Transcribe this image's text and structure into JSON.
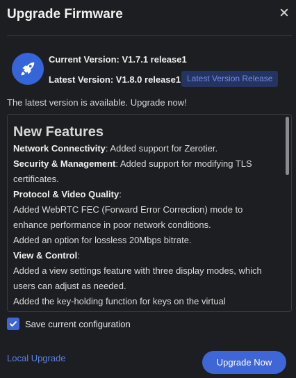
{
  "dialog": {
    "title": "Upgrade Firmware",
    "close_icon": "close-icon"
  },
  "versions": {
    "icon": "rocket-icon",
    "current": "Current Version: V1.7.1 release1",
    "latest": "Latest Version: V1.8.0 release1",
    "release_link": "Latest Version Release"
  },
  "status_text": "The latest version is available. Upgrade now!",
  "release_notes": {
    "heading": "New Features",
    "lines": [
      {
        "bold": "Network Connectivity",
        "text": ": Added support for Zerotier."
      },
      {
        "bold": "Security & Management",
        "text": ": Added support for modifying TLS certificates."
      },
      {
        "bold": "Protocol & Video Quality",
        "text": ":"
      },
      {
        "bold": "",
        "text": "Added WebRTC FEC (Forward Error Correction) mode to enhance performance in poor network conditions."
      },
      {
        "bold": "",
        "text": "Added an option for lossless 20Mbps bitrate."
      },
      {
        "bold": "View & Control",
        "text": ":"
      },
      {
        "bold": "",
        "text": "Added a view settings feature with three display modes, which users can adjust as needed."
      },
      {
        "bold": "",
        "text": "Added the key-holding function for keys on the virtual"
      }
    ]
  },
  "save_config": {
    "label": "Save current configuration",
    "checked": true
  },
  "footer": {
    "local_upgrade": "Local Upgrade",
    "upgrade_now": "Upgrade Now"
  },
  "colors": {
    "background": "#1d1e22",
    "accent": "#3e66d6",
    "link": "#5b80e0"
  }
}
